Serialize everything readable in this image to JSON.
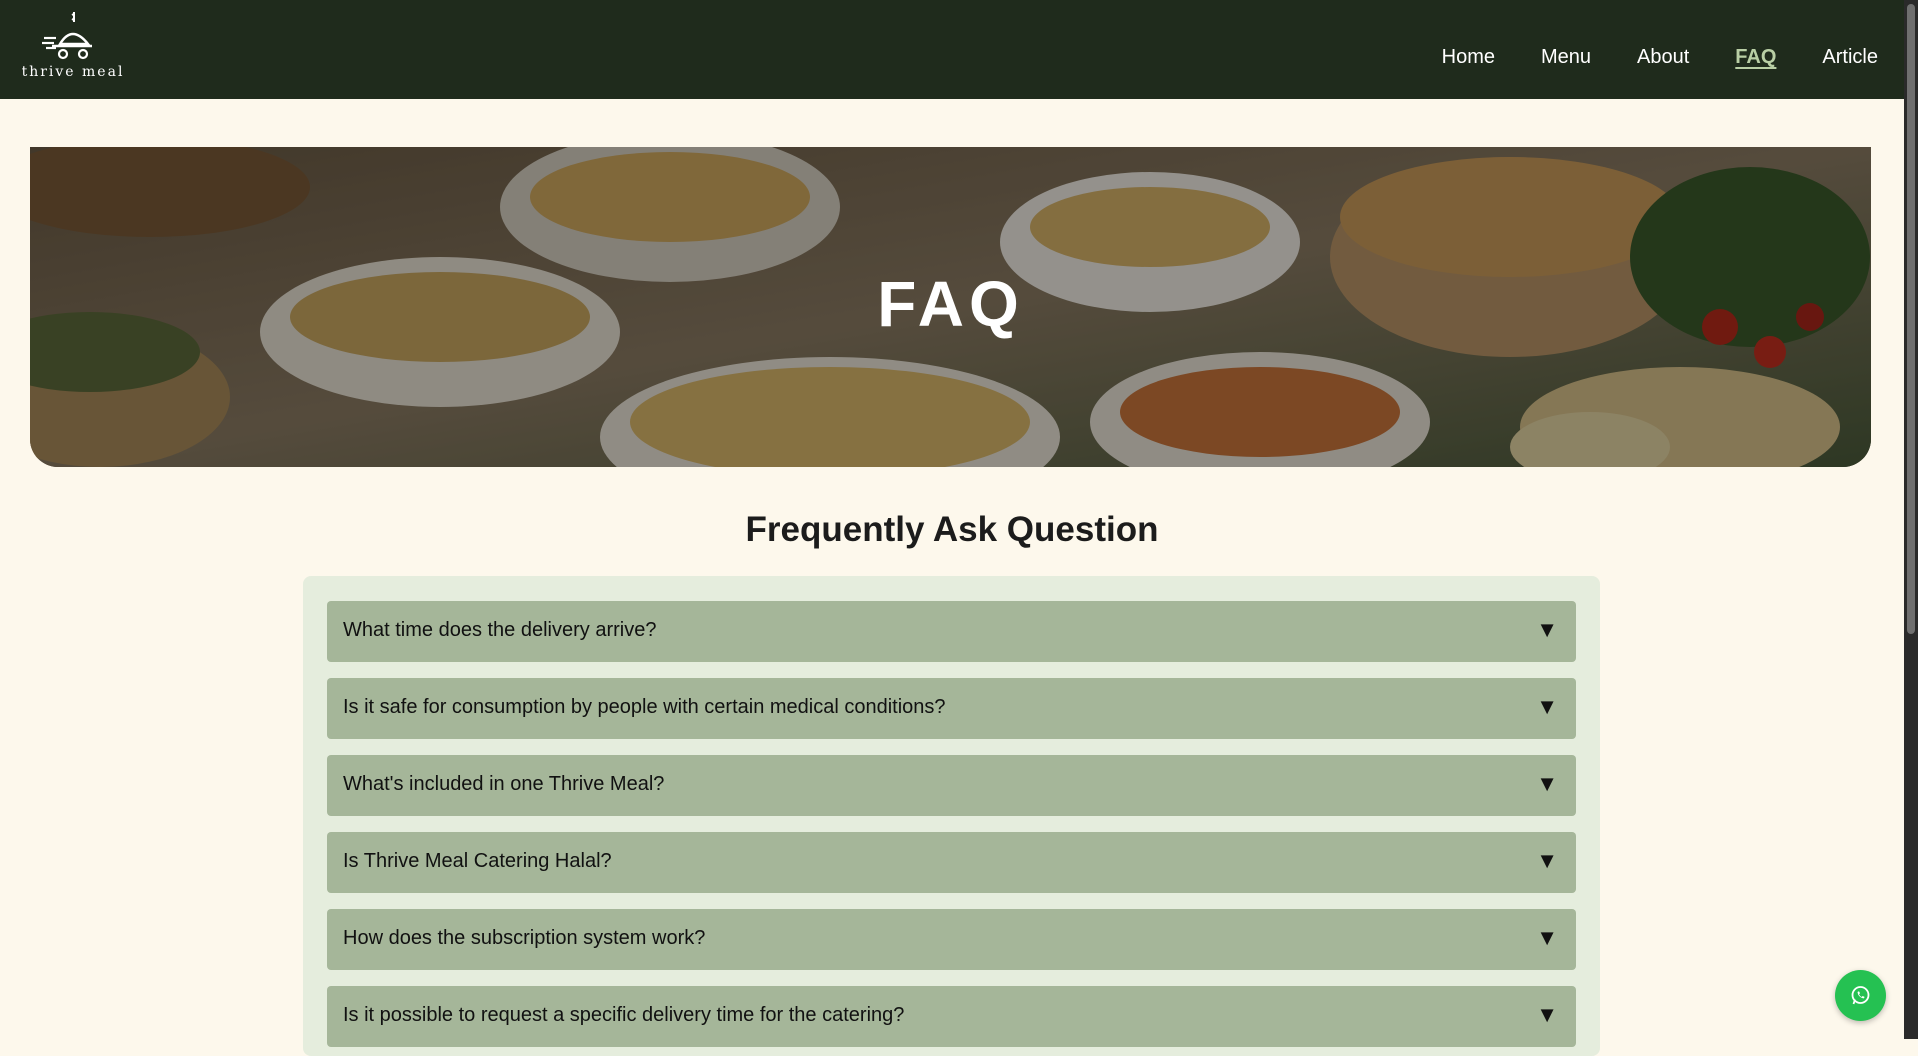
{
  "brand": {
    "name": "thrive meal"
  },
  "nav": {
    "items": [
      {
        "label": "Home"
      },
      {
        "label": "Menu"
      },
      {
        "label": "About"
      },
      {
        "label": "FAQ",
        "active": true
      },
      {
        "label": "Article"
      }
    ]
  },
  "hero": {
    "title": "FAQ"
  },
  "faq": {
    "title": "Frequently Ask Question",
    "items": [
      {
        "question": "What time does the delivery arrive?"
      },
      {
        "question": "Is it safe for consumption by people with certain medical conditions?"
      },
      {
        "question": "What's included in one Thrive Meal?"
      },
      {
        "question": "Is Thrive Meal Catering Halal?"
      },
      {
        "question": "How does the subscription system work?"
      },
      {
        "question": "Is it possible to request a specific delivery time for the catering?"
      }
    ],
    "toggle_icon": "▼"
  },
  "colors": {
    "navbar": "#1f2b1c",
    "page_bg": "#fdf8ec",
    "faq_panel": "#e5eddd",
    "faq_item": "#a5b699",
    "active_nav": "#b9cfa5",
    "whatsapp": "#25c152"
  },
  "icons": {
    "logo": "delivery-cart-icon",
    "whatsapp": "whatsapp-icon"
  }
}
